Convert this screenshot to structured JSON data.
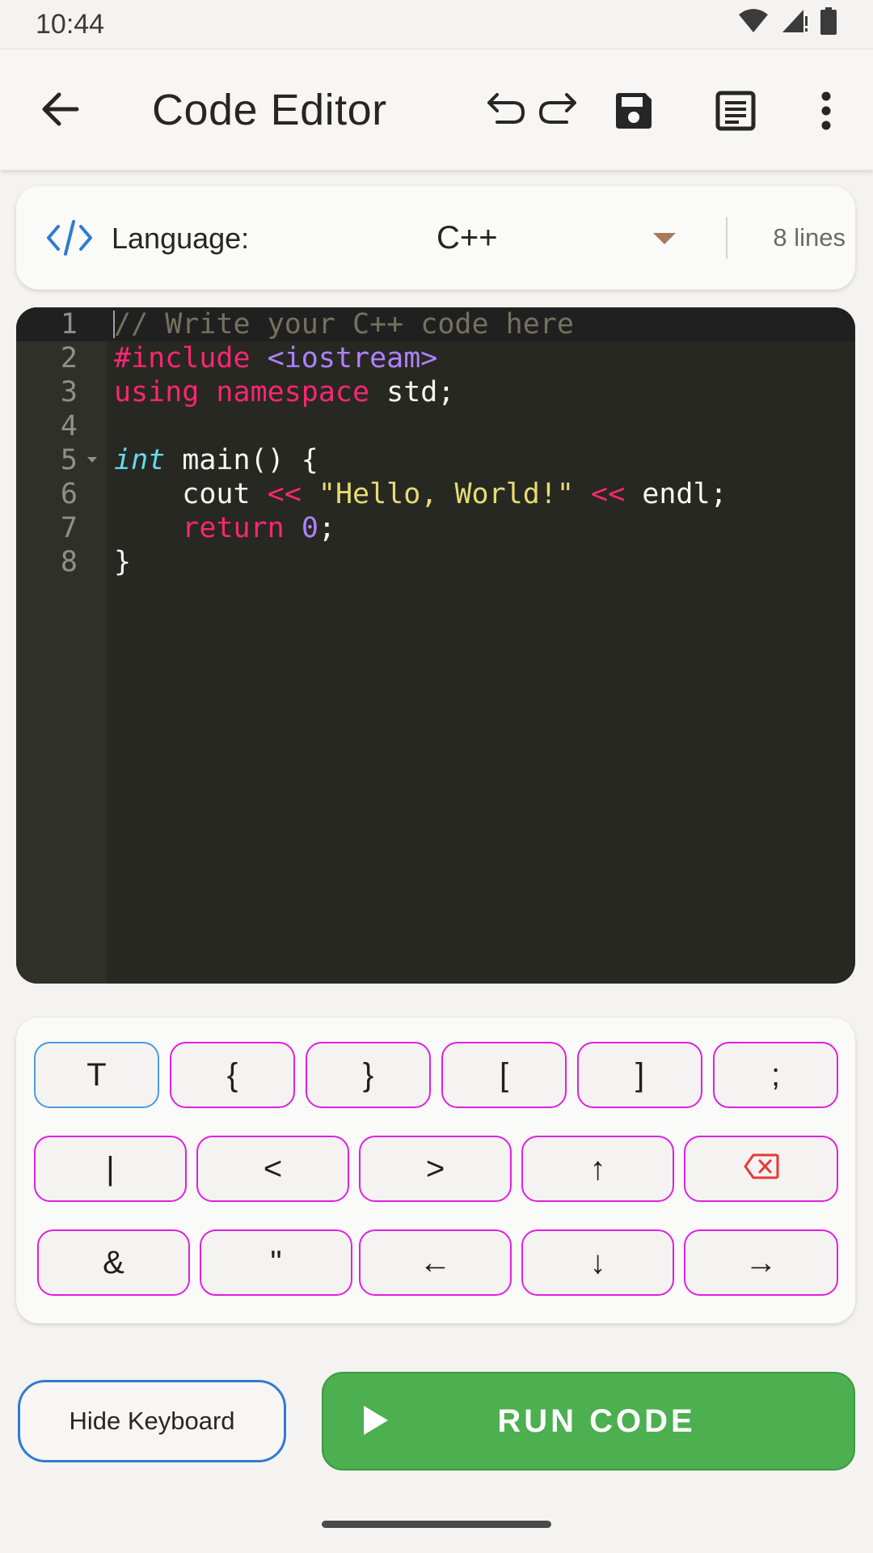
{
  "status_bar": {
    "time": "10:44",
    "icons": [
      "wifi-icon",
      "signal-icon",
      "battery-icon"
    ]
  },
  "app_bar": {
    "title": "Code Editor",
    "icons": [
      "back-arrow-icon",
      "undo-icon",
      "redo-icon",
      "save-icon",
      "document-icon",
      "more-vert-icon"
    ]
  },
  "language_card": {
    "icon": "code-icon",
    "label": "Language:",
    "selected": "C++",
    "line_count": "8 lines"
  },
  "editor": {
    "lines": [
      {
        "num": "1",
        "tokens": [
          {
            "t": "// Write your C++ code here",
            "c": "c-comment"
          }
        ]
      },
      {
        "num": "2",
        "tokens": [
          {
            "t": "#include ",
            "c": "c-kw"
          },
          {
            "t": "<iostream>",
            "c": "c-lib"
          }
        ]
      },
      {
        "num": "3",
        "tokens": [
          {
            "t": "using namespace",
            "c": "c-kw"
          },
          {
            "t": " std;",
            "c": "c-plain"
          }
        ]
      },
      {
        "num": "4",
        "tokens": []
      },
      {
        "num": "5",
        "tokens": [
          {
            "t": "int",
            "c": "c-type"
          },
          {
            "t": " main() {",
            "c": "c-plain"
          }
        ]
      },
      {
        "num": "6",
        "tokens": [
          {
            "t": "    cout ",
            "c": "c-plain"
          },
          {
            "t": "<<",
            "c": "c-kw"
          },
          {
            "t": " ",
            "c": "c-plain"
          },
          {
            "t": "\"Hello, World!\"",
            "c": "c-str"
          },
          {
            "t": " ",
            "c": "c-plain"
          },
          {
            "t": "<<",
            "c": "c-kw"
          },
          {
            "t": " endl;",
            "c": "c-plain"
          }
        ]
      },
      {
        "num": "7",
        "tokens": [
          {
            "t": "    ",
            "c": "c-plain"
          },
          {
            "t": "return",
            "c": "c-kw"
          },
          {
            "t": " ",
            "c": "c-plain"
          },
          {
            "t": "0",
            "c": "c-num"
          },
          {
            "t": ";",
            "c": "c-plain"
          }
        ]
      },
      {
        "num": "8",
        "tokens": [
          {
            "t": "}",
            "c": "c-plain"
          }
        ]
      }
    ]
  },
  "keyboard": {
    "row1": [
      "T",
      "{",
      "}",
      "[",
      "]",
      ";"
    ],
    "row2": [
      "|",
      "<",
      ">",
      "↑"
    ],
    "row3": [
      "&",
      "\"",
      "←",
      "↓",
      "→"
    ],
    "backspace_icon": "backspace-icon"
  },
  "buttons": {
    "hide_keyboard": "Hide Keyboard",
    "run_code": "RUN CODE"
  },
  "colors": {
    "run_green": "#4caf50",
    "key_border": "#e020e0",
    "accent_blue": "#2f7bd2",
    "editor_bg": "#272822"
  }
}
